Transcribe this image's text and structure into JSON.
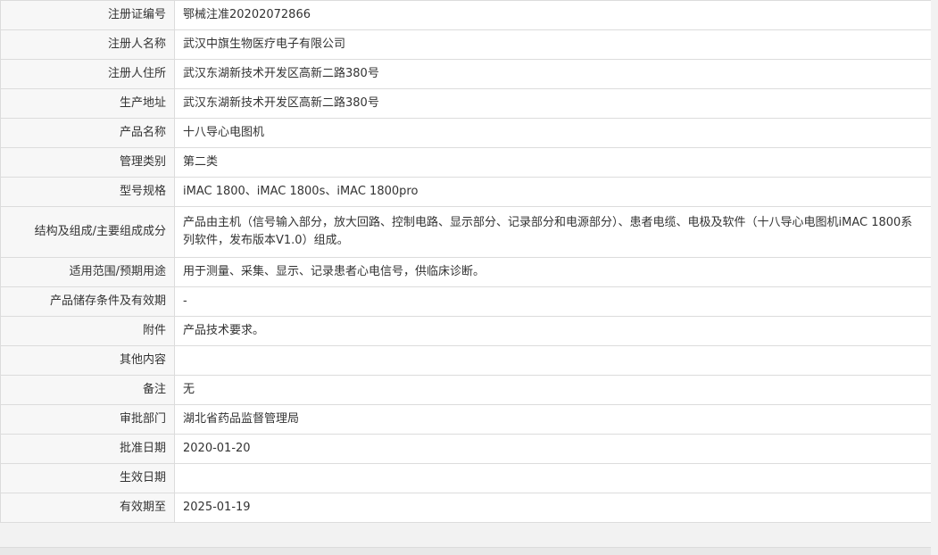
{
  "rows": [
    {
      "label": "注册证编号",
      "value": "鄂械注准20202072866"
    },
    {
      "label": "注册人名称",
      "value": "武汉中旗生物医疗电子有限公司"
    },
    {
      "label": "注册人住所",
      "value": "武汉东湖新技术开发区高新二路380号"
    },
    {
      "label": "生产地址",
      "value": "武汉东湖新技术开发区高新二路380号"
    },
    {
      "label": "产品名称",
      "value": "十八导心电图机"
    },
    {
      "label": "管理类别",
      "value": "第二类"
    },
    {
      "label": "型号规格",
      "value": "iMAC 1800、iMAC 1800s、iMAC 1800pro"
    },
    {
      "label": "结构及组成/主要组成成分",
      "value": "产品由主机（信号输入部分，放大回路、控制电路、显示部分、记录部分和电源部分）、患者电缆、电极及软件（十八导心电图机iMAC 1800系列软件，发布版本V1.0）组成。"
    },
    {
      "label": "适用范围/预期用途",
      "value": "用于测量、采集、显示、记录患者心电信号，供临床诊断。"
    },
    {
      "label": "产品储存条件及有效期",
      "value": "-"
    },
    {
      "label": "附件",
      "value": "产品技术要求。"
    },
    {
      "label": "其他内容",
      "value": ""
    },
    {
      "label": "备注",
      "value": "无"
    },
    {
      "label": "审批部门",
      "value": "湖北省药品监督管理局"
    },
    {
      "label": "批准日期",
      "value": "2020-01-20"
    },
    {
      "label": "生效日期",
      "value": ""
    },
    {
      "label": "有效期至",
      "value": "2025-01-19"
    }
  ]
}
